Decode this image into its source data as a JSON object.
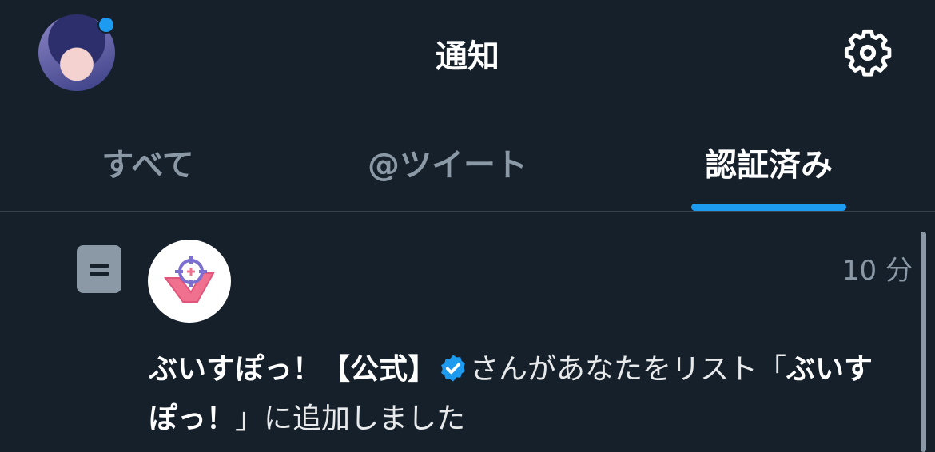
{
  "header": {
    "title": "通知",
    "avatar_icon": "user-avatar",
    "settings_icon": "gear-icon"
  },
  "tabs": [
    {
      "label": "すべて",
      "active": false
    },
    {
      "label": "@ツイート",
      "active": false
    },
    {
      "label": "認証済み",
      "active": true
    }
  ],
  "notification": {
    "type_icon": "list-icon",
    "time": "10 分",
    "actor": "ぶいすぽっ！【公式】",
    "text_middle": "さんがあなたをリスト「",
    "list_name": "ぶいすぽっ！",
    "text_end": "」に追加しました"
  },
  "colors": {
    "background": "#15202b",
    "accent": "#1d9bf0",
    "muted": "#8b98a5"
  }
}
